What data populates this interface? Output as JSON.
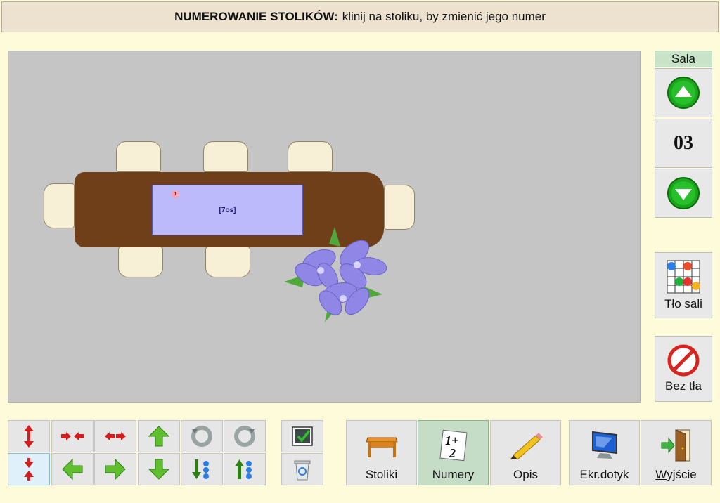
{
  "header": {
    "bold": "NUMEROWANIE STOLIKÓW:",
    "text": "klinij na stoliku, by zmienić jego numer"
  },
  "canvas": {
    "table": {
      "label": "[7os]",
      "number": "1"
    }
  },
  "side": {
    "sala_label": "Sala",
    "room_number": "03",
    "bg_label": "Tło sali",
    "nobg_label": "Bez tła"
  },
  "tools": [
    "move-up-down",
    "compress-horizontal",
    "expand-horizontal",
    "arrow-up",
    "rotate-left",
    "rotate-right",
    "compress-vertical",
    "arrow-left",
    "arrow-right",
    "arrow-down",
    "sort-down",
    "sort-up"
  ],
  "bottom": {
    "stoliki": "Stoliki",
    "numery": "Numery",
    "opis": "Opis",
    "ekr": "Ekr.dotyk",
    "wyjscie_first": "W",
    "wyjscie_rest": "yjście"
  },
  "colors": {
    "canvas": "#c5c5c5",
    "table": "#6f3f1a",
    "label": "#bdbafb",
    "accent_green": "#1aa51a",
    "active_button": "#c5dcc6"
  }
}
